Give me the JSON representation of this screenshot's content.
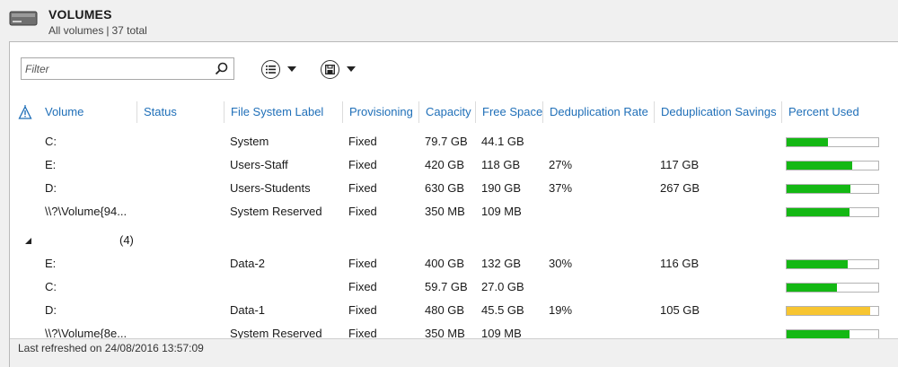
{
  "header": {
    "title": "VOLUMES",
    "subtitle_scope": "All volumes",
    "subtitle_separator": "|",
    "subtitle_count": "37 total",
    "icon": "drive-icon"
  },
  "toolbar": {
    "filter_placeholder": "Filter",
    "search_icon": "search-icon",
    "tasks_icon": "list-icon",
    "save_icon": "save-icon"
  },
  "columns": {
    "warning": "warning-icon",
    "volume": "Volume",
    "status": "Status",
    "fs_label": "File System Label",
    "provisioning": "Provisioning",
    "capacity": "Capacity",
    "free_space": "Free Space",
    "dedup_rate": "Deduplication Rate",
    "dedup_savings": "Deduplication Savings",
    "percent_used": "Percent Used"
  },
  "rows": [
    {
      "volume": "C:",
      "status": "",
      "fs_label": "System",
      "provisioning": "Fixed",
      "capacity": "79.7 GB",
      "free_space": "44.1 GB",
      "dedup_rate": "",
      "dedup_savings": "",
      "percent_used": 0.45,
      "bar_color": "#14b814"
    },
    {
      "volume": "E:",
      "status": "",
      "fs_label": "Users-Staff",
      "provisioning": "Fixed",
      "capacity": "420 GB",
      "free_space": "118 GB",
      "dedup_rate": "27%",
      "dedup_savings": "117 GB",
      "percent_used": 0.72,
      "bar_color": "#14b814"
    },
    {
      "volume": "D:",
      "status": "",
      "fs_label": "Users-Students",
      "provisioning": "Fixed",
      "capacity": "630 GB",
      "free_space": "190 GB",
      "dedup_rate": "37%",
      "dedup_savings": "267 GB",
      "percent_used": 0.7,
      "bar_color": "#14b814"
    },
    {
      "volume": "\\\\?\\Volume{94...",
      "status": "",
      "fs_label": "System Reserved",
      "provisioning": "Fixed",
      "capacity": "350 MB",
      "free_space": "109 MB",
      "dedup_rate": "",
      "dedup_savings": "",
      "percent_used": 0.69,
      "bar_color": "#14b814"
    }
  ],
  "group": {
    "count": "(4)"
  },
  "group_rows": [
    {
      "volume": "E:",
      "status": "",
      "fs_label": "Data-2",
      "provisioning": "Fixed",
      "capacity": "400 GB",
      "free_space": "132 GB",
      "dedup_rate": "30%",
      "dedup_savings": "116 GB",
      "percent_used": 0.67,
      "bar_color": "#14b814"
    },
    {
      "volume": "C:",
      "status": "",
      "fs_label": "",
      "provisioning": "Fixed",
      "capacity": "59.7 GB",
      "free_space": "27.0 GB",
      "dedup_rate": "",
      "dedup_savings": "",
      "percent_used": 0.55,
      "bar_color": "#14b814"
    },
    {
      "volume": "D:",
      "status": "",
      "fs_label": "Data-1",
      "provisioning": "Fixed",
      "capacity": "480 GB",
      "free_space": "45.5 GB",
      "dedup_rate": "19%",
      "dedup_savings": "105 GB",
      "percent_used": 0.91,
      "bar_color": "#f7c531"
    },
    {
      "volume": "\\\\?\\Volume{8e...",
      "status": "",
      "fs_label": "System Reserved",
      "provisioning": "Fixed",
      "capacity": "350 MB",
      "free_space": "109 MB",
      "dedup_rate": "",
      "dedup_savings": "",
      "percent_used": 0.69,
      "bar_color": "#14b814"
    }
  ],
  "statusbar": {
    "text": "Last refreshed on 24/08/2016 13:57:09"
  }
}
